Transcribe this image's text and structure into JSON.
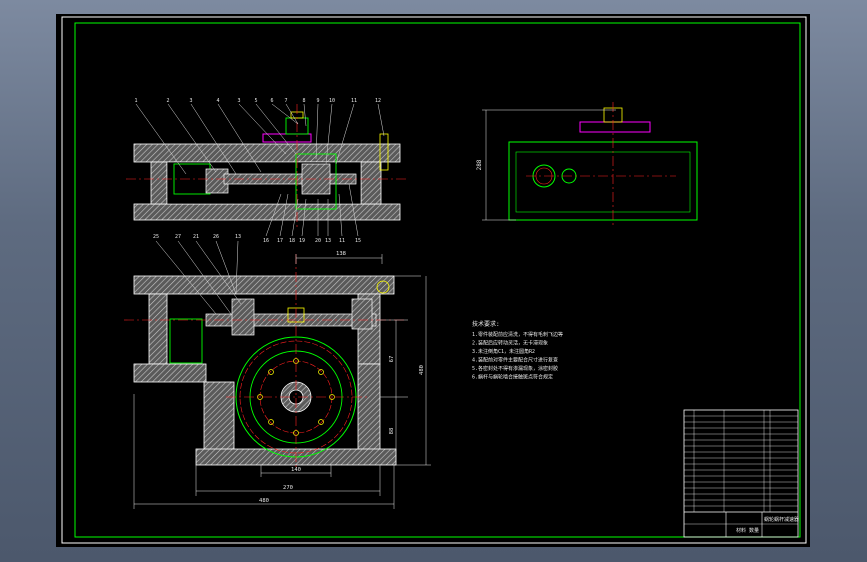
{
  "callouts_top": [
    "1",
    "2",
    "3",
    "4",
    "3",
    "5",
    "6",
    "7",
    "8",
    "9",
    "10",
    "11",
    "12"
  ],
  "callouts_bottom": [
    "16",
    "17",
    "18",
    "19",
    "20",
    "13",
    "11",
    "15"
  ],
  "callouts_plan": [
    "25",
    "27",
    "21",
    "26",
    "13"
  ],
  "dimensions": {
    "side_height": "288",
    "plan_top_width": "138",
    "plan_total_height": "480",
    "plan_inner_width": "270",
    "plan_overall_width": "480",
    "plan_base_width": "140",
    "plan_right_1": "67",
    "plan_right_2": "88"
  },
  "notes": {
    "heading": "技术要求:",
    "lines": [
      "1.零件装配前应清洗，不得有毛刺飞边等",
      "2.装配后应转动灵活，无卡滞现象",
      "3.未注倒角C1，未注圆角R2",
      "4.装配前对零件主要配合尺寸进行复查",
      "5.各密封处不得有渗漏现象，涂密封胶",
      "6.蜗杆与蜗轮啮合接触斑点符合规定"
    ]
  },
  "title_block": {
    "stamp": "材料 数量",
    "drawing_name": "蜗轮蜗杆减速器"
  },
  "colors": {
    "outline": "#ffffff",
    "hatch": "#bfbfbf",
    "dimension": "#e8e8e8",
    "centerline": "#ff2020",
    "frame": "#00ff00",
    "gear": "#00ff00",
    "key": "#ff00ff",
    "fastener": "#ffff00"
  }
}
